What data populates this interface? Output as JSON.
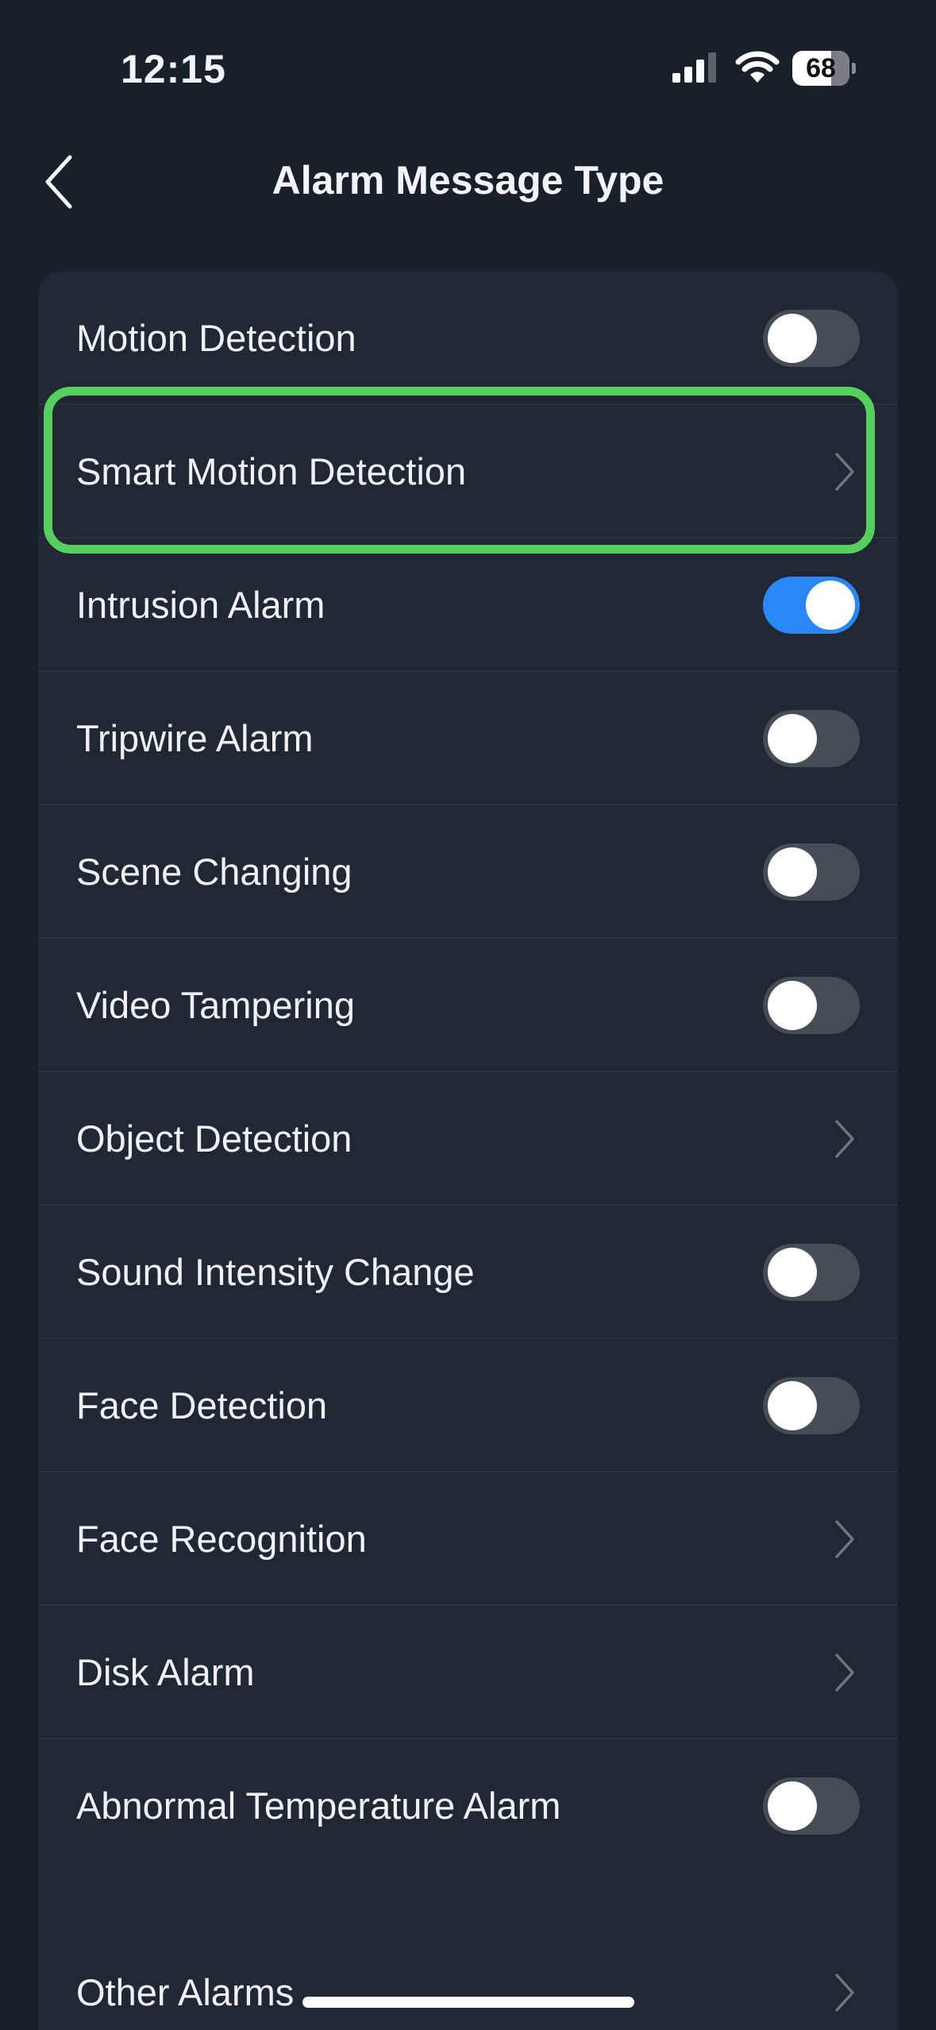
{
  "status_bar": {
    "time": "12:15",
    "battery_level": "68",
    "battery_percent": 68,
    "signal_icon": "cellular-signal-icon",
    "wifi_icon": "wifi-icon"
  },
  "nav": {
    "back_icon": "chevron-left-icon",
    "title": "Alarm Message Type"
  },
  "colors": {
    "background": "#19202a",
    "card": "#212833",
    "toggle_on": "#2b86f7",
    "toggle_off": "#474d57",
    "highlight": "#56cf60"
  },
  "items": [
    {
      "label": "Motion Detection",
      "control": "toggle",
      "on": false
    },
    {
      "label": "Smart Motion Detection",
      "control": "chevron",
      "highlighted": true
    },
    {
      "label": "Intrusion Alarm",
      "control": "toggle",
      "on": true
    },
    {
      "label": "Tripwire Alarm",
      "control": "toggle",
      "on": false
    },
    {
      "label": "Scene Changing",
      "control": "toggle",
      "on": false
    },
    {
      "label": "Video Tampering",
      "control": "toggle",
      "on": false
    },
    {
      "label": "Object Detection",
      "control": "chevron"
    },
    {
      "label": "Sound Intensity Change",
      "control": "toggle",
      "on": false
    },
    {
      "label": "Face Detection",
      "control": "toggle",
      "on": false
    },
    {
      "label": "Face Recognition",
      "control": "chevron"
    },
    {
      "label": "Disk Alarm",
      "control": "chevron"
    },
    {
      "label": "Abnormal Temperature Alarm",
      "control": "toggle",
      "on": false
    },
    {
      "label": "Other Alarms",
      "control": "chevron"
    }
  ]
}
